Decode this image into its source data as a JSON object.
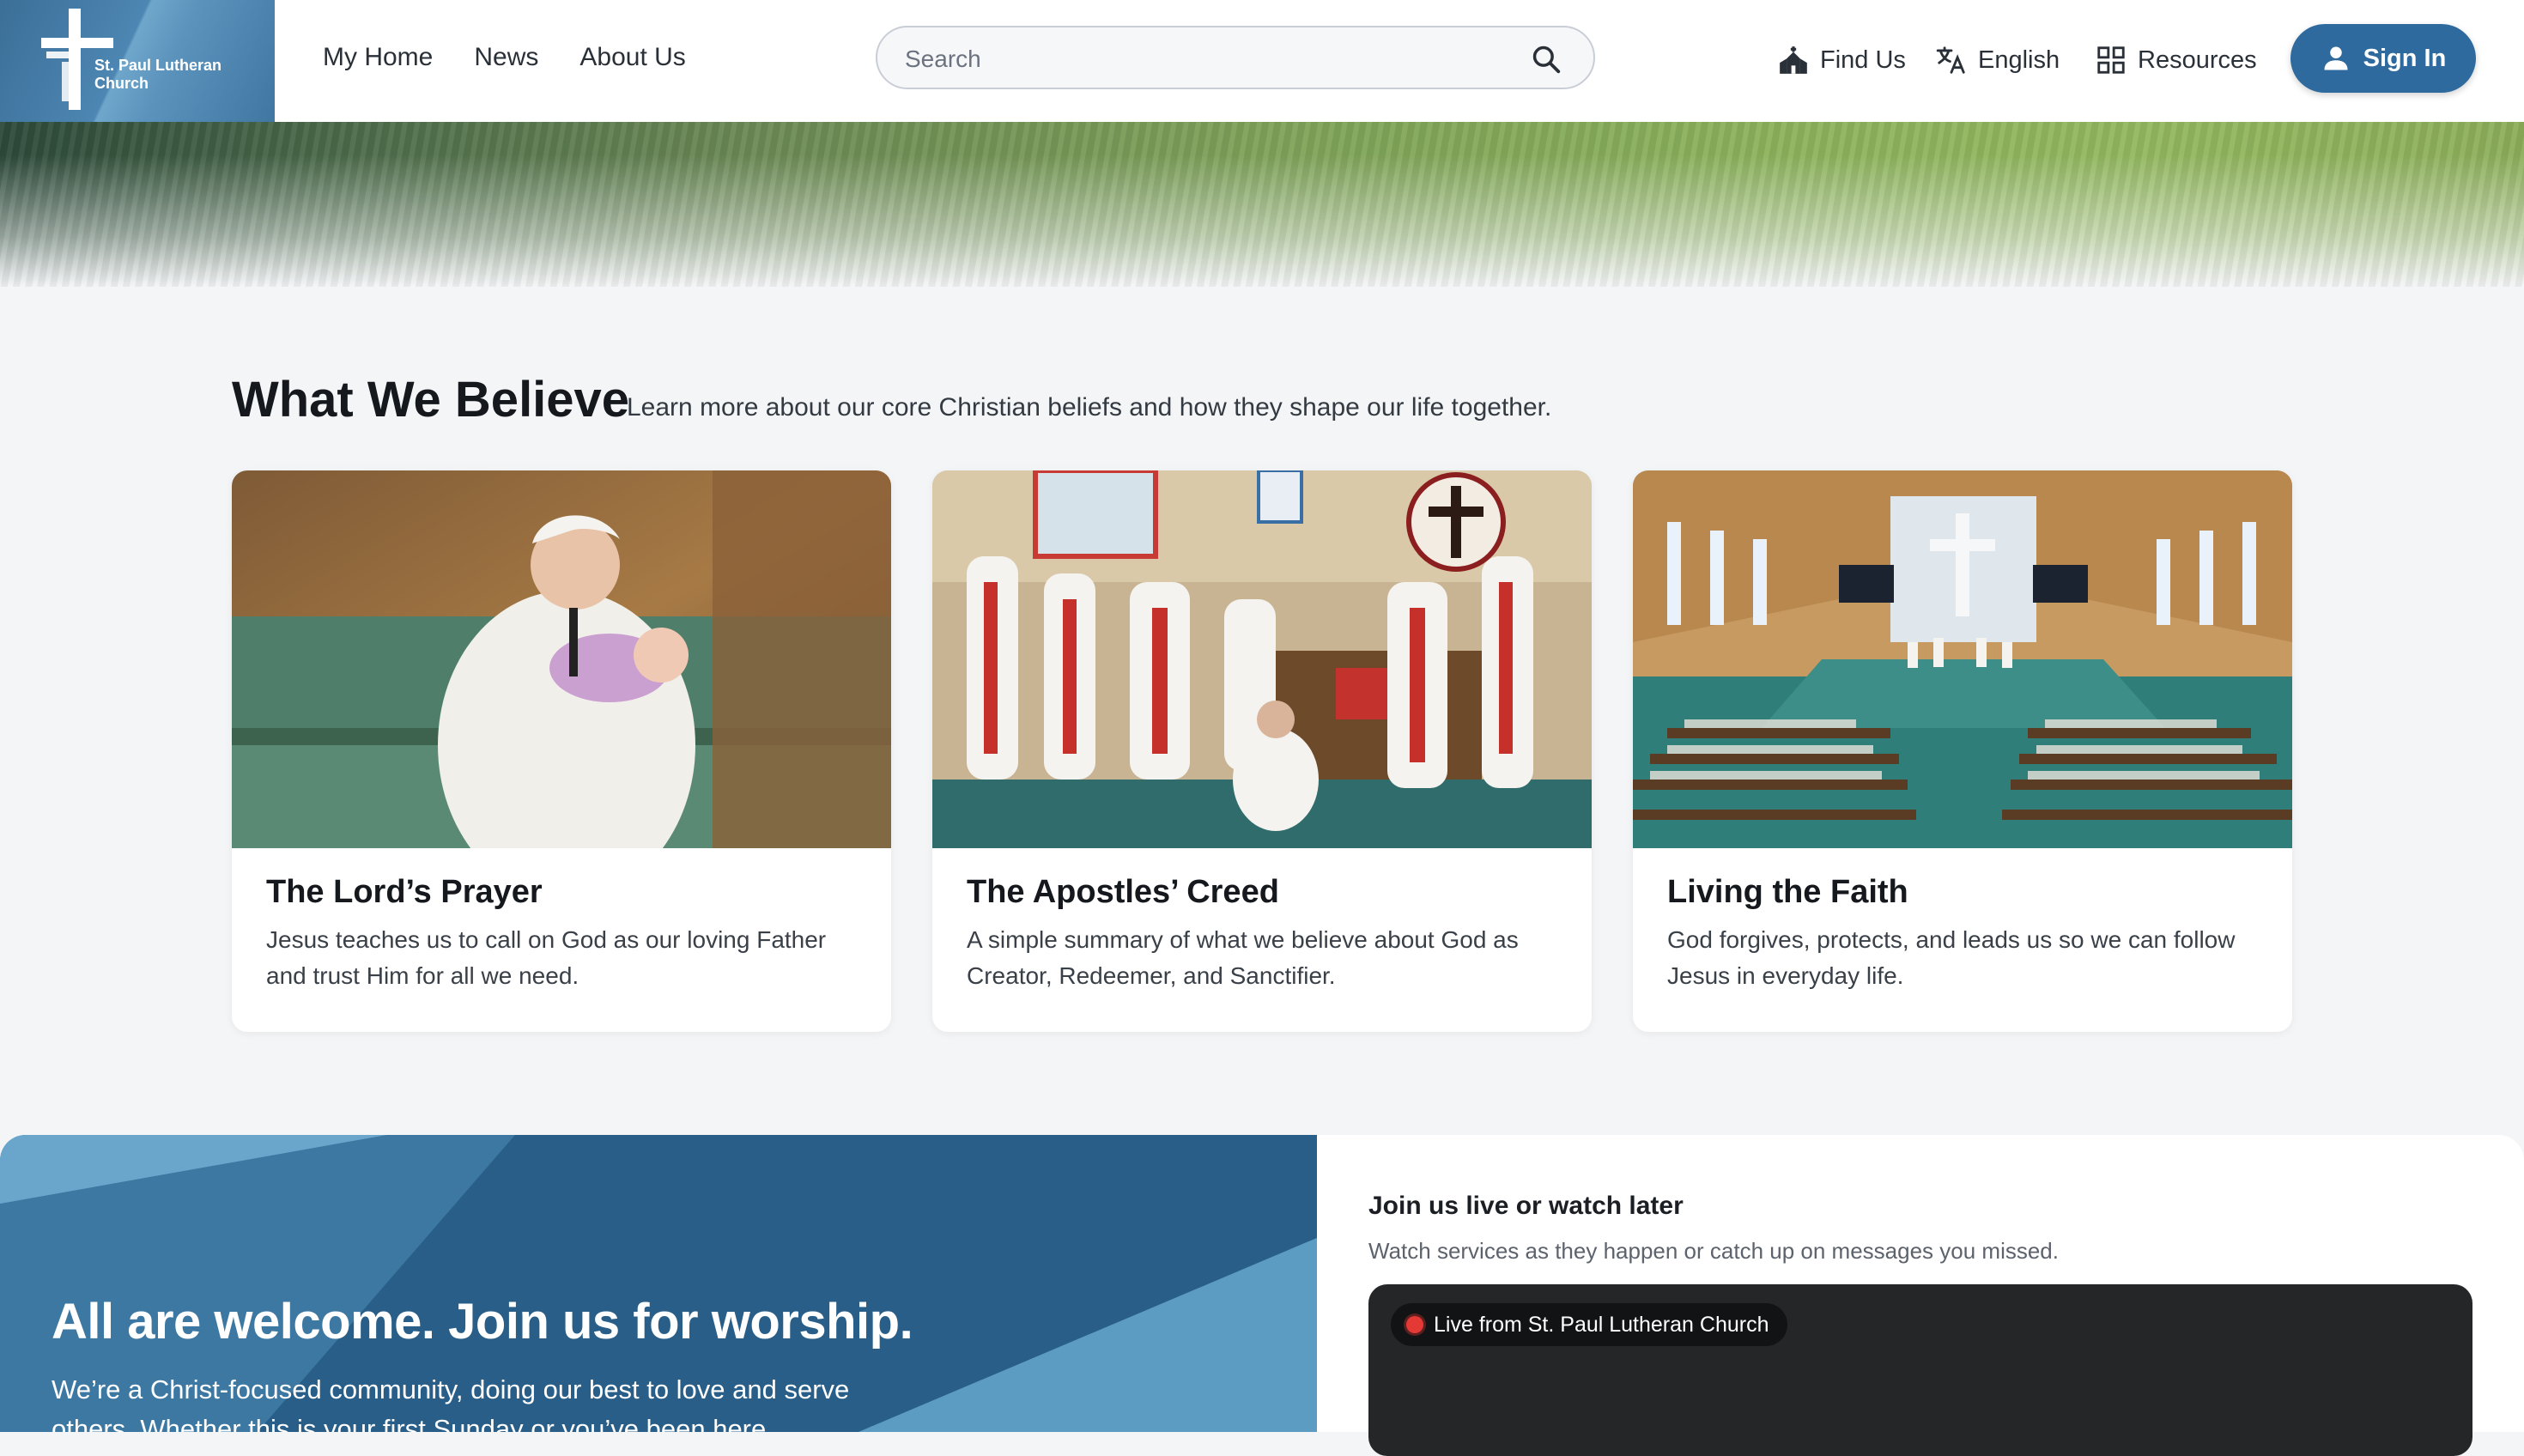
{
  "brand": {
    "line1": "St. Paul Lutheran",
    "line2": "Church"
  },
  "nav": [
    "My Home",
    "News",
    "About Us"
  ],
  "search": {
    "placeholder": "Search",
    "value": ""
  },
  "utils": {
    "find_us": "Find Us",
    "language": "English",
    "resources": "Resources",
    "sign_in": "Sign In"
  },
  "beliefs": {
    "title": "What We Believe",
    "subtitle": "Learn more about our core Christian beliefs and how they shape our life together.",
    "cards": [
      {
        "title": "The Lord’s Prayer",
        "text": "Jesus teaches us to call on God as our loving Father and trust Him for all we need."
      },
      {
        "title": "The Apostles’ Creed",
        "text": "A simple summary of what we believe about God as Creator, Redeemer, and Sanctifier."
      },
      {
        "title": "Living the Faith",
        "text": "God forgives, protects, and leads us so we can follow Jesus in everyday life."
      }
    ]
  },
  "welcome": {
    "heading": "All are welcome. Join us for worship.",
    "text": "We’re a Christ-focused community, doing our best to love and serve others. Whether this is your first Sunday or you’ve been here"
  },
  "video": {
    "heading": "Join us live or watch later",
    "subtitle": "Watch services as they happen or catch up on messages you missed.",
    "live_label": "Live from St. Paul Lutheran Church"
  },
  "colors": {
    "primary": "#2f6a9e",
    "live": "#e53935"
  }
}
